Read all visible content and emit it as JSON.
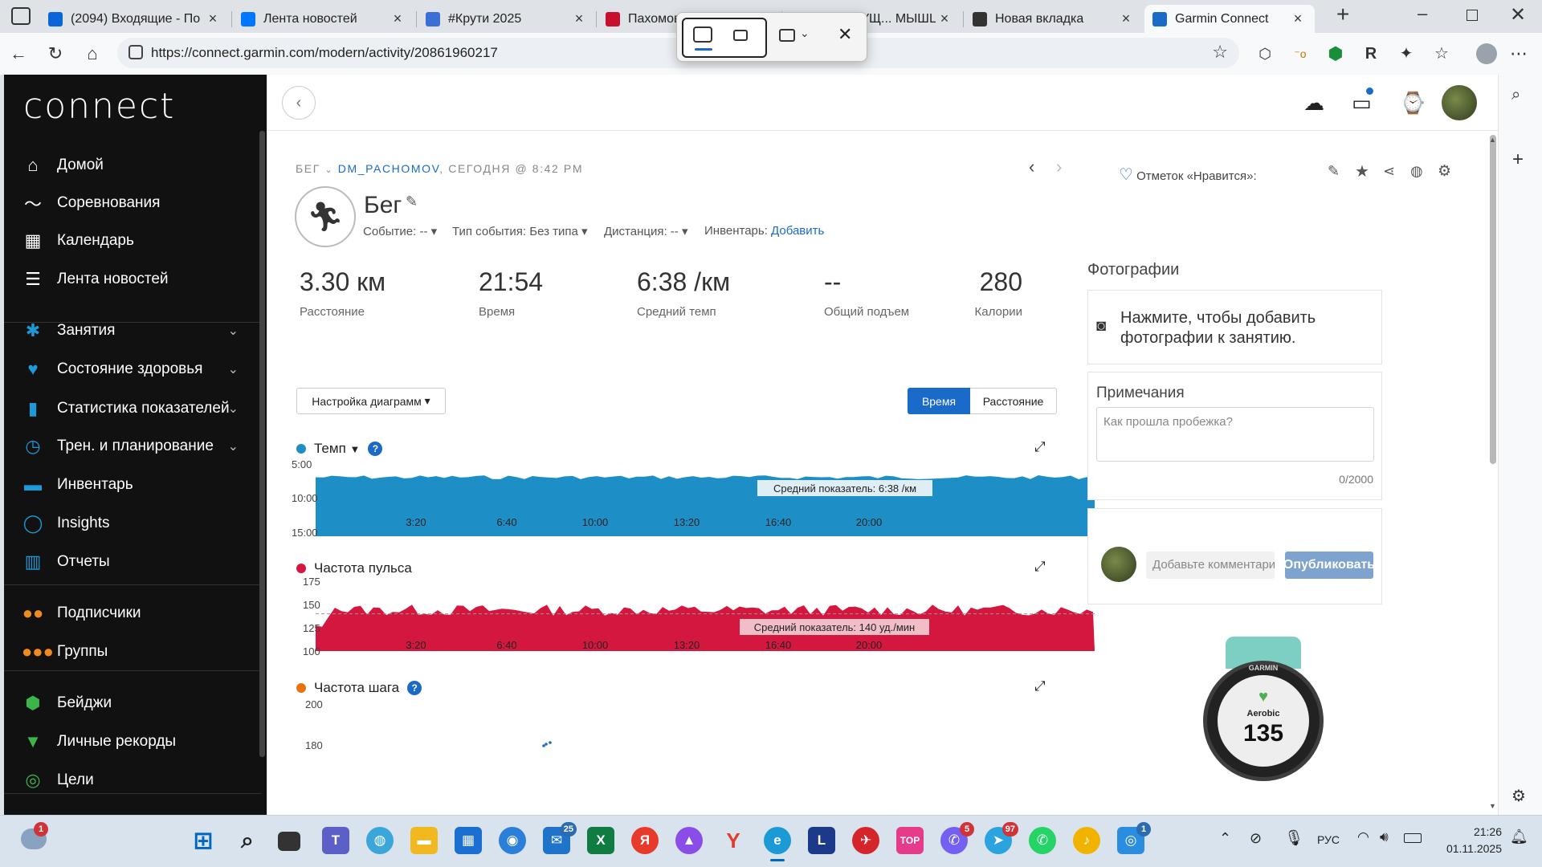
{
  "browser": {
    "tabs": [
      {
        "title": "(2094) Входящие - По",
        "color": "#0a66d8",
        "icon": "mail-icon"
      },
      {
        "title": "Лента новостей",
        "color": "#0077ff",
        "icon": "vk-icon"
      },
      {
        "title": "#Крути 2025",
        "color": "#3b6fd8",
        "icon": "site-icon"
      },
      {
        "title": "Пахомов",
        "color": "#c8102e",
        "icon": "flag-icon"
      },
      {
        "title": "ХВАН-ЛУЩ... МЫШЦ",
        "color": "#666666",
        "icon": "site-icon"
      },
      {
        "title": "Новая вкладка",
        "color": "#333333",
        "icon": "newtab-icon"
      },
      {
        "title": "Garmin Connect",
        "color": "#1a6ac9",
        "icon": "garmin-icon"
      }
    ],
    "url": "https://connect.garmin.com/modern/activity/20861960217"
  },
  "sidebar": {
    "logo": "connect",
    "items": [
      {
        "label": "Домой",
        "icon": "home-icon",
        "glyph": "⌂",
        "chev": false
      },
      {
        "label": "Соревнования",
        "icon": "challenge-icon",
        "glyph": "〜",
        "chev": false
      },
      {
        "label": "Календарь",
        "icon": "calendar-icon",
        "glyph": "▦",
        "chev": false
      },
      {
        "label": "Лента новостей",
        "icon": "newsfeed-icon",
        "glyph": "☰",
        "chev": false
      },
      {
        "label": "Занятия",
        "icon": "activity-icon",
        "glyph": "✱",
        "chev": true
      },
      {
        "label": "Состояние здоровья",
        "icon": "heart-icon",
        "glyph": "♥",
        "chev": true
      },
      {
        "label": "Статистика показателей",
        "icon": "stats-icon",
        "glyph": "▮",
        "chev": true
      },
      {
        "label": "Трен. и планирование",
        "icon": "stopwatch-icon",
        "glyph": "◷",
        "chev": true
      },
      {
        "label": "Инвентарь",
        "icon": "shoe-icon",
        "glyph": "▬",
        "chev": false
      },
      {
        "label": "Insights",
        "icon": "lightbulb-icon",
        "glyph": "◯",
        "chev": false
      },
      {
        "label": "Отчеты",
        "icon": "report-icon",
        "glyph": "▥",
        "chev": false
      },
      {
        "label": "Подписчики",
        "icon": "followers-icon",
        "glyph": "●●",
        "chev": false
      },
      {
        "label": "Группы",
        "icon": "groups-icon",
        "glyph": "●●●",
        "chev": false
      },
      {
        "label": "Бейджи",
        "icon": "badge-icon",
        "glyph": "⬢",
        "chev": false
      },
      {
        "label": "Личные рекорды",
        "icon": "trophy-icon",
        "glyph": "▼",
        "chev": false
      },
      {
        "label": "Цели",
        "icon": "goal-icon",
        "glyph": "◎",
        "chev": false
      }
    ]
  },
  "activity": {
    "crumb_type": "БЕГ",
    "crumb_user": "DM_PACHOMOV",
    "crumb_time": "СЕГОДНЯ @ 8:42 PM",
    "title": "Бег",
    "event": "Событие: --",
    "event_type": "Тип события: Без типа",
    "distance_sel": "Дистанция: --",
    "inventory_label": "Инвентарь:",
    "inventory_link": "Добавить",
    "likes": "Отметок «Нравится»:",
    "metrics": [
      {
        "value": "3.30 км",
        "label": "Расстояние"
      },
      {
        "value": "21:54",
        "label": "Время"
      },
      {
        "value": "6:38 /км",
        "label": "Средний темп"
      },
      {
        "value": "--",
        "label": "Общий подъем"
      },
      {
        "value": "280",
        "label": "Калории"
      }
    ],
    "chart_settings": "Настройка диаграмм",
    "toggle": [
      "Время",
      "Расстояние"
    ]
  },
  "chart_data": [
    {
      "type": "area",
      "title": "Темп",
      "color": "#1e8fc6",
      "y_ticks": [
        "5:00",
        "10:00",
        "15:00"
      ],
      "x_ticks": [
        "3:20",
        "6:40",
        "10:00",
        "13:20",
        "16:40",
        "20:00"
      ],
      "average_label": "Средний показатель: 6:38 /км"
    },
    {
      "type": "area",
      "title": "Частота пульса",
      "color": "#d4173f",
      "y_ticks": [
        "175",
        "150",
        "125",
        "100"
      ],
      "ylim": [
        100,
        175
      ],
      "x_ticks": [
        "3:20",
        "6:40",
        "10:00",
        "13:20",
        "16:40",
        "20:00"
      ],
      "average": 140,
      "average_label": "Средний показатель: 140 уд./мин"
    },
    {
      "type": "scatter",
      "title": "Частота шага",
      "color": "#e8730c",
      "y_ticks": [
        "200",
        "180"
      ]
    }
  ],
  "right": {
    "photos_title": "Фотографии",
    "photos_prompt": "Нажмите, чтобы добавить фотографии к занятию.",
    "notes_title": "Примечания",
    "notes_placeholder": "Как прошла пробежка?",
    "notes_count": "0/2000",
    "comment_placeholder": "Добавьте комментарий, и",
    "publish": "Опубликовать",
    "watch_brand": "GARMIN",
    "watch_mode": "Aerobic",
    "watch_value": "135"
  },
  "taskbar": {
    "weather_badge": "1",
    "lang": "РУС",
    "time": "21:26",
    "date": "01.11.2025",
    "mail_badge": "25",
    "viber_badge": "5",
    "telegram_badge": "97",
    "chat_badge": "1"
  }
}
